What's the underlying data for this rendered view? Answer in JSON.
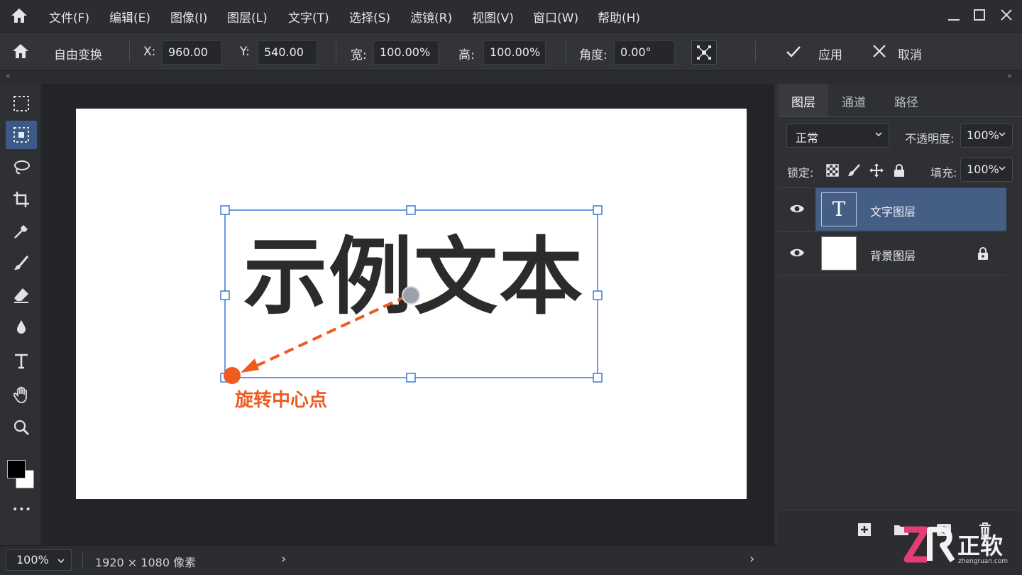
{
  "menu": {
    "items": [
      "文件(F)",
      "编辑(E)",
      "图像(I)",
      "图层(L)",
      "文字(T)",
      "选择(S)",
      "滤镜(R)",
      "视图(V)",
      "窗口(W)",
      "帮助(H)"
    ]
  },
  "window_controls": [
    "minimize-icon",
    "maximize-icon",
    "close-icon"
  ],
  "options": {
    "mode": "自由变换",
    "x_label": "X:",
    "x_value": "960.00",
    "y_label": "Y:",
    "y_value": "540.00",
    "width_label": "宽:",
    "width_value": "100.00%",
    "height_label": "高:",
    "height_value": "100.00%",
    "angle_label": "角度:",
    "angle_value": "0.00°",
    "apply_label": "应用",
    "cancel_label": "取消"
  },
  "strip": {
    "left": "«",
    "right": "»"
  },
  "tools": [
    "marquee-icon",
    "object-select-icon",
    "lasso-icon",
    "crop-icon",
    "eyedropper-icon",
    "brush-icon",
    "eraser-icon",
    "blur-drop-icon",
    "type-icon",
    "hand-icon",
    "zoom-icon",
    "color-swatches",
    "more-icon"
  ],
  "toolbar": {
    "more": "•••"
  },
  "canvas": {
    "text": "示例文本",
    "pivot_label": "旋转中心点",
    "accent_color": "#ef5a1f",
    "handle_color": "#3a7bd5"
  },
  "panel": {
    "tabs": [
      "图层",
      "通道",
      "路径"
    ],
    "blend_mode": "正常",
    "opacity_label": "不透明度:",
    "opacity_value": "100%",
    "lock_label": "锁定:",
    "fill_label": "填充:",
    "fill_value": "100%",
    "layers": [
      {
        "name": "文字图层",
        "thumb": "T",
        "selected": true,
        "locked": false
      },
      {
        "name": "背景图层",
        "thumb": "",
        "selected": false,
        "locked": true
      }
    ]
  },
  "status": {
    "zoom": "100%",
    "doc_info": "1920 × 1080 像素",
    "arrow": "›"
  },
  "watermark": {
    "logo": "ZR",
    "name": "正软",
    "url": "zhengruan.com"
  }
}
